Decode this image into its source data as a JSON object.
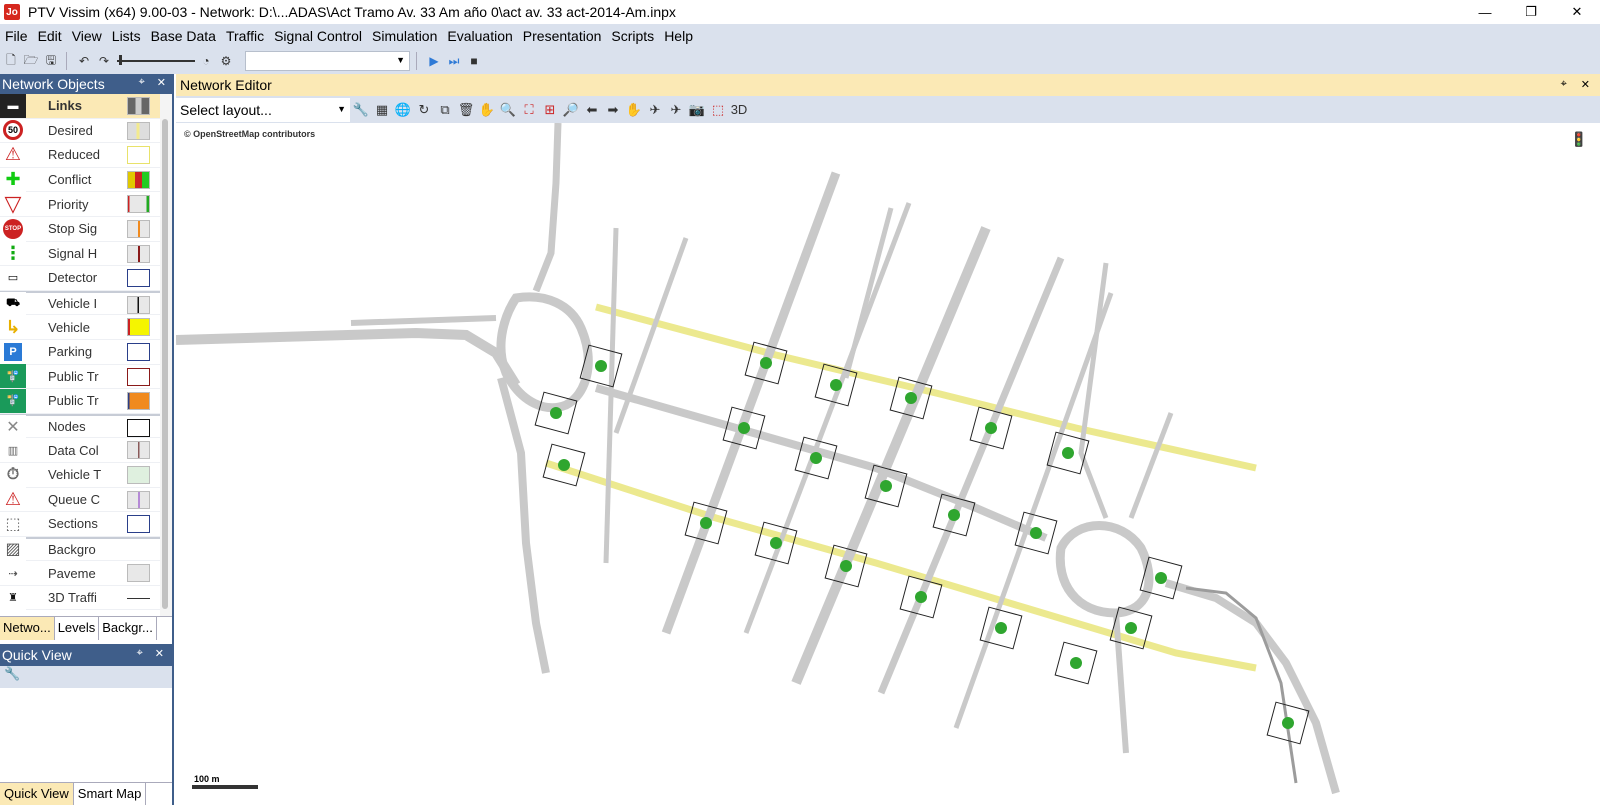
{
  "window": {
    "title": "PTV Vissim (x64) 9.00-03 - Network: D:\\...ADAS\\Act Tramo Av. 33 Am año 0\\act av. 33 act-2014-Am.inpx",
    "app_icon_text": "Jo",
    "minimize": "—",
    "restore": "❐",
    "close": "✕"
  },
  "menu": [
    "File",
    "Edit",
    "View",
    "Lists",
    "Base Data",
    "Traffic",
    "Signal Control",
    "Simulation",
    "Evaluation",
    "Presentation",
    "Scripts",
    "Help"
  ],
  "network_objects": {
    "title": "Network Objects",
    "pin": "⌖",
    "close": "✕",
    "items": [
      {
        "label": "Links",
        "icon": "links-icon",
        "glyph": "▬",
        "selected": true
      },
      {
        "label": "Desired",
        "icon": "speed-50-icon",
        "glyph": "50"
      },
      {
        "label": "Reduced",
        "icon": "reduced-speed-icon",
        "glyph": "⚠"
      },
      {
        "label": "Conflict",
        "icon": "conflict-icon",
        "glyph": "✚"
      },
      {
        "label": "Priority",
        "icon": "priority-icon",
        "glyph": "▽"
      },
      {
        "label": "Stop Sig",
        "icon": "stop-sign-icon",
        "glyph": "STOP"
      },
      {
        "label": "Signal H",
        "icon": "signal-head-icon",
        "glyph": "⋮"
      },
      {
        "label": "Detector",
        "icon": "detector-icon",
        "glyph": "▭"
      },
      {
        "label": "Vehicle I",
        "icon": "vehicle-input-icon",
        "glyph": "⛟"
      },
      {
        "label": "Vehicle",
        "icon": "vehicle-route-icon",
        "glyph": "↳"
      },
      {
        "label": "Parking",
        "icon": "parking-icon",
        "glyph": "P"
      },
      {
        "label": "Public Tr",
        "icon": "public-transport-stop-icon",
        "glyph": "🚏"
      },
      {
        "label": "Public Tr",
        "icon": "public-transport-line-icon",
        "glyph": "🚏"
      },
      {
        "label": "Nodes",
        "icon": "nodes-icon",
        "glyph": "✕"
      },
      {
        "label": "Data Col",
        "icon": "data-collection-icon",
        "glyph": "▥"
      },
      {
        "label": "Vehicle T",
        "icon": "vehicle-travel-time-icon",
        "glyph": "⏱"
      },
      {
        "label": "Queue C",
        "icon": "queue-counter-icon",
        "glyph": "⚠"
      },
      {
        "label": "Sections",
        "icon": "sections-icon",
        "glyph": "⬚"
      },
      {
        "label": "Backgro",
        "icon": "background-icon",
        "glyph": "▨"
      },
      {
        "label": "Paveme",
        "icon": "pavement-marking-icon",
        "glyph": "⇢"
      },
      {
        "label": "3D Traffi",
        "icon": "3d-traffic-signal-icon",
        "glyph": "♜"
      }
    ],
    "tabs": [
      "Netwo...",
      "Levels",
      "Backgr..."
    ]
  },
  "quick_view": {
    "title": "Quick View",
    "pin": "⌖",
    "close": "✕",
    "tool_glyph": "🔧",
    "tabs": [
      "Quick View",
      "Smart Map"
    ]
  },
  "network_editor": {
    "title": "Network Editor",
    "pin": "⌖",
    "close": "✕",
    "layout_placeholder": "Select layout...",
    "osm_credit": "© OpenStreetMap contributors",
    "scale_label": "100 m"
  },
  "colors": {
    "panel_header": "#3f5e8a",
    "selected_bg": "#fbe9b5",
    "toolbar_bg": "#dae1ed",
    "link_gray": "#c9c9c9",
    "link_yellow": "#ece98f",
    "node_green": "#2fa62f"
  }
}
